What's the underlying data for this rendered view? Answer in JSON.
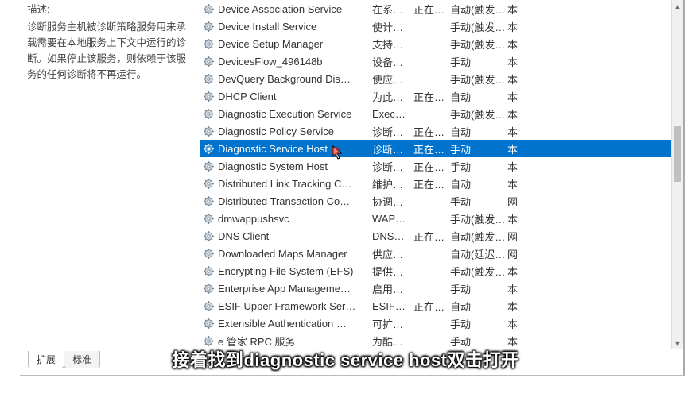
{
  "description": {
    "label": "描述:",
    "text": "诊断服务主机被诊断策略服务用来承载需要在本地服务上下文中运行的诊断。如果停止该服务，则依赖于该服务的任何诊断将不再运行。"
  },
  "services": [
    {
      "name": "Device Association Service",
      "desc": "在系…",
      "status": "正在…",
      "startup": "自动(触发…",
      "logon": "本"
    },
    {
      "name": "Device Install Service",
      "desc": "使计…",
      "status": "",
      "startup": "手动(触发…",
      "logon": "本"
    },
    {
      "name": "Device Setup Manager",
      "desc": "支持…",
      "status": "",
      "startup": "手动(触发…",
      "logon": "本"
    },
    {
      "name": "DevicesFlow_496148b",
      "desc": "设备…",
      "status": "",
      "startup": "手动",
      "logon": "本"
    },
    {
      "name": "DevQuery Background Dis…",
      "desc": "使应…",
      "status": "",
      "startup": "手动(触发…",
      "logon": "本"
    },
    {
      "name": "DHCP Client",
      "desc": "为此…",
      "status": "正在…",
      "startup": "自动",
      "logon": "本"
    },
    {
      "name": "Diagnostic Execution Service",
      "desc": "Exec…",
      "status": "",
      "startup": "手动(触发…",
      "logon": "本"
    },
    {
      "name": "Diagnostic Policy Service",
      "desc": "诊断…",
      "status": "正在…",
      "startup": "自动",
      "logon": "本"
    },
    {
      "name": "Diagnostic Service Host",
      "desc": "诊断…",
      "status": "正在…",
      "startup": "手动",
      "logon": "本",
      "selected": true
    },
    {
      "name": "Diagnostic System Host",
      "desc": "诊断…",
      "status": "正在…",
      "startup": "手动",
      "logon": "本"
    },
    {
      "name": "Distributed Link Tracking C…",
      "desc": "维护…",
      "status": "正在…",
      "startup": "自动",
      "logon": "本"
    },
    {
      "name": "Distributed Transaction Co…",
      "desc": "协调…",
      "status": "",
      "startup": "手动",
      "logon": "网"
    },
    {
      "name": "dmwappushsvc",
      "desc": "WAP…",
      "status": "",
      "startup": "手动(触发…",
      "logon": "本"
    },
    {
      "name": "DNS Client",
      "desc": "DNS…",
      "status": "正在…",
      "startup": "自动(触发…",
      "logon": "网"
    },
    {
      "name": "Downloaded Maps Manager",
      "desc": "供应…",
      "status": "",
      "startup": "自动(延迟…",
      "logon": "网"
    },
    {
      "name": "Encrypting File System (EFS)",
      "desc": "提供…",
      "status": "",
      "startup": "手动(触发…",
      "logon": "本"
    },
    {
      "name": "Enterprise App Manageme…",
      "desc": "启用…",
      "status": "",
      "startup": "手动",
      "logon": "本"
    },
    {
      "name": "ESIF Upper Framework Ser…",
      "desc": "ESIF…",
      "status": "正在…",
      "startup": "自动",
      "logon": "本"
    },
    {
      "name": "Extensible Authentication …",
      "desc": "可扩…",
      "status": "",
      "startup": "手动",
      "logon": "本"
    },
    {
      "name": "e 管家 RPC 服务",
      "desc": "为酷…",
      "status": "",
      "startup": "手动",
      "logon": "本"
    }
  ],
  "tabs": {
    "extended": "扩展",
    "standard": "标准"
  },
  "caption": "接着找到diagnostic service host双击打开",
  "colors": {
    "selection": "#0173cd"
  }
}
